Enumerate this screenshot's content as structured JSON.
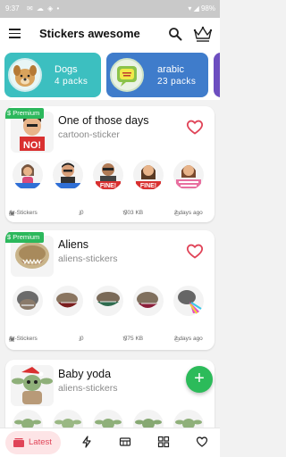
{
  "status": {
    "time": "9:37",
    "battery": "98%"
  },
  "header": {
    "title": "Stickers awesome",
    "menu_icon": "hamburger-menu-icon",
    "search_icon": "search-icon",
    "premium_icon": "crown-icon"
  },
  "categories": [
    {
      "name": "Dogs",
      "count": "4 packs",
      "color": "#3cbfc0"
    },
    {
      "name": "arabic",
      "count": "23 packs",
      "color": "#3f7ccb"
    },
    {
      "color": "#6d4ec0"
    }
  ],
  "packs": [
    {
      "premium": "$ Premium",
      "name": "One of those days",
      "publisher": "cartoon-sticker",
      "stickers": [
        "girl-sticker",
        "man-sticker",
        "fine-man-sticker",
        "fine-woman-sticker",
        "thank-you-sticker"
      ],
      "author": "Ar-Stickers",
      "downloads": "0",
      "size": "703 KB",
      "age": "2 days ago"
    },
    {
      "premium": "$ Premium",
      "name": "Aliens",
      "publisher": "aliens-stickers",
      "stickers": [
        "alien-sticker-1",
        "alien-sticker-2",
        "alien-sticker-3",
        "alien-sticker-4",
        "alien-sticker-5"
      ],
      "author": "Ar-Stickers",
      "downloads": "0",
      "size": "775 KB",
      "age": "2 days ago"
    },
    {
      "name": "Baby yoda",
      "publisher": "aliens-stickers",
      "stickers": [
        "yoda-sticker-1",
        "yoda-sticker-2",
        "yoda-sticker-3",
        "yoda-sticker-4",
        "yoda-sticker-5"
      ]
    }
  ],
  "fab": {
    "label": "+"
  },
  "nav": {
    "latest": "Latest",
    "accent": "#e04458"
  }
}
